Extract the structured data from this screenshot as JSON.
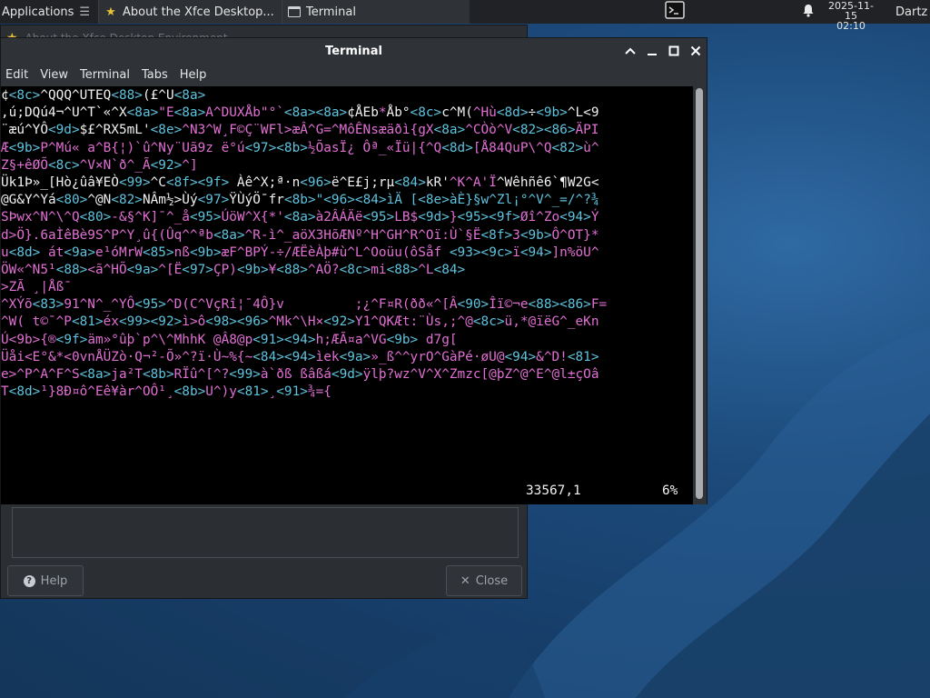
{
  "panel": {
    "applications": "Applications",
    "tasks": [
      {
        "label": "About the Xfce Desktop..."
      },
      {
        "label": "Terminal"
      }
    ],
    "date": "2025-11-15",
    "time": "02:10",
    "user": "Dartz"
  },
  "about_dialog": {
    "title": "About the Xfce Desktop Environment",
    "help_label": "Help",
    "close_label": "Close"
  },
  "terminal": {
    "title": "Terminal",
    "menu": [
      "Edit",
      "View",
      "Terminal",
      "Tabs",
      "Help"
    ],
    "lines": [
      [
        [
          "w",
          "¢"
        ],
        [
          "c",
          "<8c>"
        ],
        [
          "w",
          "^QQQ^UTEQ"
        ],
        [
          "c",
          "<88>"
        ],
        [
          "w",
          "(£^U"
        ],
        [
          "c",
          "<8a>"
        ]
      ],
      [
        [
          "w",
          ",ú;DQú4¬^U^T`«^X"
        ],
        [
          "c",
          "<8a>"
        ],
        [
          "m",
          "\"E"
        ],
        [
          "c",
          "<8a>"
        ],
        [
          "m",
          "A^DUXÅb\"°`"
        ],
        [
          "c",
          "<8a><8a>"
        ],
        [
          "w",
          "¢ÅEb"
        ],
        [
          "m",
          "*"
        ],
        [
          "w",
          "Åb°"
        ],
        [
          "c",
          "<8c>"
        ],
        [
          "w",
          "c^M("
        ],
        [
          "m",
          "^Hù"
        ],
        [
          "c",
          "<8d>"
        ],
        [
          "w",
          "÷"
        ],
        [
          "c",
          "<9b>"
        ],
        [
          "w",
          "^L<9"
        ]
      ],
      [
        [
          "w",
          "¨æú^YÔ"
        ],
        [
          "c",
          "<9d>"
        ],
        [
          "w",
          "$£^RX5mL'"
        ],
        [
          "c",
          "<8e>"
        ],
        [
          "m",
          "^N3^W¸F©Ç¨WFl>æÂ^G=^MôÊNsæäðì{gX"
        ],
        [
          "c",
          "<8a>"
        ],
        [
          "m",
          "^CÒò^V"
        ],
        [
          "c",
          "<82><86>"
        ],
        [
          "m",
          "ÄPI"
        ]
      ],
      [
        [
          "m",
          "Æ"
        ],
        [
          "c",
          "<9b>"
        ],
        [
          "m",
          "P^Mú« a^B{¦)`û^Ny¨Uã9z ë°ú"
        ],
        [
          "c",
          "<97><8b>"
        ],
        [
          "m",
          "½ÕasÏ¿ Ôª_«Ïü|{^Q"
        ],
        [
          "c",
          "<8d>"
        ],
        [
          "m",
          "[Å84QuP\\^Q"
        ],
        [
          "c",
          "<82>"
        ],
        [
          "m",
          "ù^"
        ]
      ],
      [
        [
          "m",
          "Z§+êØÕ"
        ],
        [
          "c",
          "<8c>"
        ],
        [
          "m",
          "^V×N`ð^_Ã"
        ],
        [
          "c",
          "<92>"
        ],
        [
          "m",
          "^]"
        ]
      ],
      [
        [
          "w",
          "Ük1Þ»_[Hò¿ûâ¥EÒ"
        ],
        [
          "c",
          "<99>"
        ],
        [
          "w",
          "^C"
        ],
        [
          "c",
          "<8f><9f>"
        ],
        [
          "w",
          " Àê^X;ª·n"
        ],
        [
          "c",
          "<96>"
        ],
        [
          "w",
          "ë^E£j;rµ"
        ],
        [
          "c",
          "<84>"
        ],
        [
          "w",
          "kR'"
        ],
        [
          "m",
          "^K^A'Ï"
        ],
        [
          "w",
          "^Wêhñê6`¶W2G<"
        ]
      ],
      [
        [
          "w",
          "@G&Y^Yá"
        ],
        [
          "c",
          "<80>"
        ],
        [
          "w",
          "^@N"
        ],
        [
          "c",
          "<82>"
        ],
        [
          "w",
          "NÂm½>Ùý"
        ],
        [
          "c",
          "<97>"
        ],
        [
          "w",
          "ŸÙýÖ¯fr"
        ],
        [
          "c",
          "<8b>\"<96><84>ìÄ [<8e>àÈ}§w^Zl¡°^V^_=/^?¾"
        ]
      ],
      [
        [
          "m",
          "SÞwx^N^\\^Q"
        ],
        [
          "c",
          "<80>"
        ],
        [
          "m",
          "-&§^K]¯^_å"
        ],
        [
          "c",
          "<95>"
        ],
        [
          "m",
          "ÚöW^X{*'"
        ],
        [
          "c",
          "<8a>"
        ],
        [
          "m",
          "à2ÂÁÄë"
        ],
        [
          "c",
          "<95>"
        ],
        [
          "m",
          "LB$"
        ],
        [
          "c",
          "<9d>"
        ],
        [
          "m",
          "}"
        ],
        [
          "c",
          "<95><9f>"
        ],
        [
          "m",
          "Øî^Zo"
        ],
        [
          "c",
          "<94>"
        ],
        [
          "m",
          "Ý"
        ]
      ],
      [
        [
          "m",
          "d>Ö}.6aÌêBè9S^P^Y¸û{(Ûq^^ªb"
        ],
        [
          "c",
          "<8a>"
        ],
        [
          "m",
          "^R-ì^_aöX3HõÆNº^H^GH^R^Oï:Ù`§Ë"
        ],
        [
          "c",
          "<8f>"
        ],
        [
          "m",
          "3"
        ],
        [
          "c",
          "<9b>"
        ],
        [
          "m",
          "Ô^OT}*"
        ]
      ],
      [
        [
          "m",
          "u"
        ],
        [
          "c",
          "<8d>"
        ],
        [
          "m",
          " át"
        ],
        [
          "c",
          "<9a>"
        ],
        [
          "m",
          "e¹óMrW"
        ],
        [
          "c",
          "<85>"
        ],
        [
          "m",
          "nß"
        ],
        [
          "c",
          "<9b>"
        ],
        [
          "m",
          "æF^BPÝ-÷/ÆËèÀþ#ù^L^Ooüu(ôSåf "
        ],
        [
          "c",
          "<93><9c>"
        ],
        [
          "m",
          "ï"
        ],
        [
          "c",
          "<94>"
        ],
        [
          "m",
          "]n%öU^"
        ]
      ],
      [
        [
          "m",
          "ÖW«^N5¹"
        ],
        [
          "c",
          "<88>"
        ],
        [
          "m",
          "<ã^HÕ"
        ],
        [
          "c",
          "<9a>"
        ],
        [
          "m",
          "^[Ë"
        ],
        [
          "c",
          "<97>"
        ],
        [
          "m",
          "ÇP)"
        ],
        [
          "c",
          "<9b>"
        ],
        [
          "m",
          "¥"
        ],
        [
          "c",
          "<88>"
        ],
        [
          "m",
          "^AÖ?"
        ],
        [
          "c",
          "<8c>"
        ],
        [
          "m",
          "mi"
        ],
        [
          "c",
          "<88>"
        ],
        [
          "m",
          "^L"
        ],
        [
          "c",
          "<84>"
        ]
      ],
      [
        [
          "m",
          ">ZÃ ¸|Åß¯"
        ]
      ],
      [
        [
          "m",
          "^XÝõ"
        ],
        [
          "c",
          "<83>"
        ],
        [
          "m",
          "91^N^_^YÔ"
        ],
        [
          "c",
          "<95>"
        ],
        [
          "m",
          "^D(C^VçRî¦¯4Ô}v         ;¿^F¤R(ðð«^[Â"
        ],
        [
          "c",
          "<90>"
        ],
        [
          "m",
          "Îï©¬e"
        ],
        [
          "c",
          "<88><86>"
        ],
        [
          "m",
          "F="
        ]
      ],
      [
        [
          "m",
          "^W( t©¯^P"
        ],
        [
          "c",
          "<81>"
        ],
        [
          "m",
          "éx"
        ],
        [
          "c",
          "<99><92>"
        ],
        [
          "m",
          "ì>ô"
        ],
        [
          "c",
          "<98><96>"
        ],
        [
          "m",
          "^Mk^\\H×"
        ],
        [
          "c",
          "<92>"
        ],
        [
          "m",
          "Y1^QKÆt:¨Ùs,;^@"
        ],
        [
          "c",
          "<8c>"
        ],
        [
          "m",
          "ü,*@ïëG^_eKn"
        ]
      ],
      [
        [
          "m",
          "Ú<9b>{®"
        ],
        [
          "c",
          "<9f>"
        ],
        [
          "m",
          "äm»°ûþ`p^\\^MhhK @Â8@p"
        ],
        [
          "c",
          "<91><94>"
        ],
        [
          "m",
          "h;ÆÃ¤a^VG"
        ],
        [
          "c",
          "<9b>"
        ],
        [
          "m",
          " d7g["
        ]
      ],
      [
        [
          "m",
          "Üåi<E°&*<0vnÅÜZò·Q¬²-Õ»^?ï·Ù~%{~"
        ],
        [
          "c",
          "<84><94>"
        ],
        [
          "m",
          "ìek"
        ],
        [
          "c",
          "<9a>"
        ],
        [
          "m",
          "»_ß^^yrO^GàPé·øU@"
        ],
        [
          "c",
          "<94>"
        ],
        [
          "m",
          "&^D!"
        ],
        [
          "c",
          "<81>"
        ]
      ],
      [
        [
          "m",
          "e>^P^A^F^S"
        ],
        [
          "c",
          "<8a>"
        ],
        [
          "m",
          "ja²T"
        ],
        [
          "c",
          "<8b>"
        ],
        [
          "m",
          "RÏû^[^?"
        ],
        [
          "c",
          "<99>"
        ],
        [
          "m",
          "à`ðß ßâßá"
        ],
        [
          "c",
          "<9d>"
        ],
        [
          "m",
          "ÿlþ?wz^V^X^Zmzc[@þZ^@^E^@l±çOâ"
        ]
      ],
      [
        [
          "m",
          "T"
        ],
        [
          "c",
          "<8d>"
        ],
        [
          "m",
          "¹}8Ð¤ô^Eê¥àr^OÔ¹¸"
        ],
        [
          "c",
          "<8b>"
        ],
        [
          "m",
          "U^)y"
        ],
        [
          "c",
          "<81>"
        ],
        [
          "m",
          "¸"
        ],
        [
          "c",
          "<91>"
        ],
        [
          "m",
          "¾={"
        ]
      ]
    ],
    "status_position": "33567,1",
    "status_percent": "6%",
    "scroll_fraction": 0.06
  }
}
